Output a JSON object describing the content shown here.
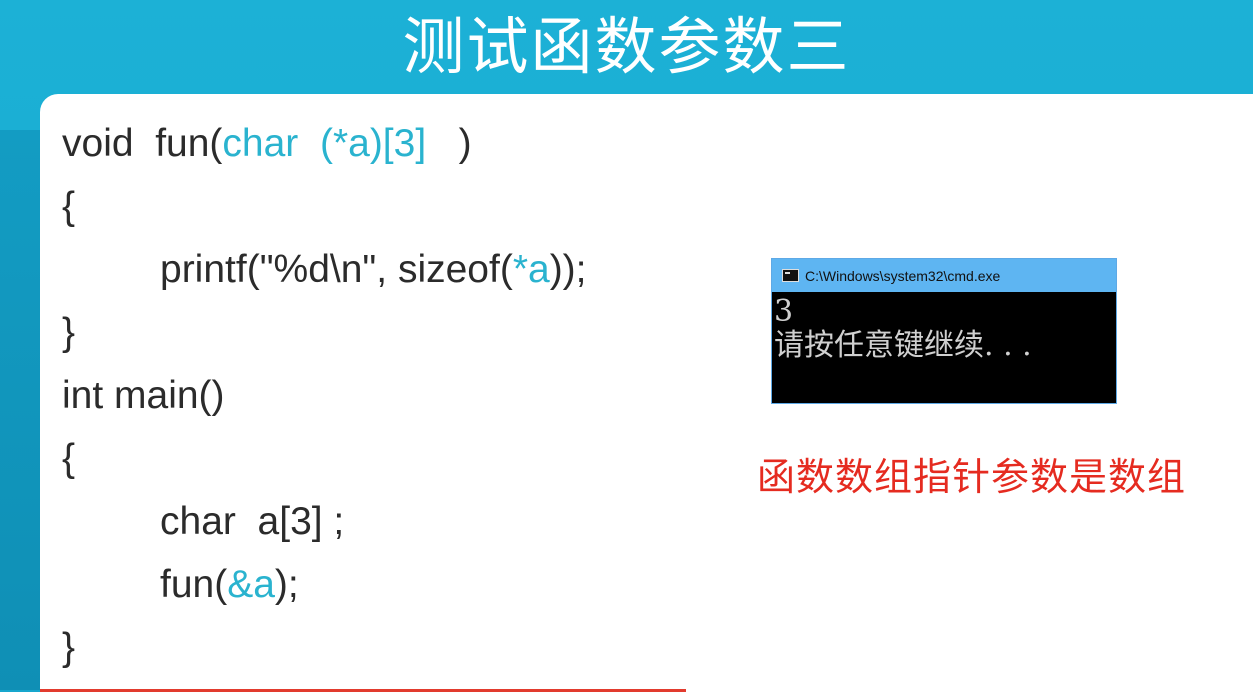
{
  "slide": {
    "title": "测试函数参数三"
  },
  "code": {
    "line1": {
      "a": "void  fun(",
      "b": "char  (*a)[3]",
      "c": "   )"
    },
    "line2": "{",
    "line3": {
      "a": "printf(\"%d\\n\", sizeof(",
      "b": "*a",
      "c": "));"
    },
    "line4": "}",
    "line5": "int main()",
    "line6": "{",
    "line7": "char  a[3] ;",
    "line8": {
      "a": "fun(",
      "b": "&a",
      "c": ");"
    },
    "line9": "}"
  },
  "console": {
    "window_title": "C:\\Windows\\system32\\cmd.exe",
    "output_line1": "3",
    "output_line2": "请按任意键继续. . .",
    "icon": "console-icon"
  },
  "note": "函数数组指针参数是数组",
  "colors": {
    "background": "#1ba8cf",
    "keyword": "#2ab3cf",
    "note": "#e52b20",
    "console_titlebar": "#5eb5f2"
  }
}
